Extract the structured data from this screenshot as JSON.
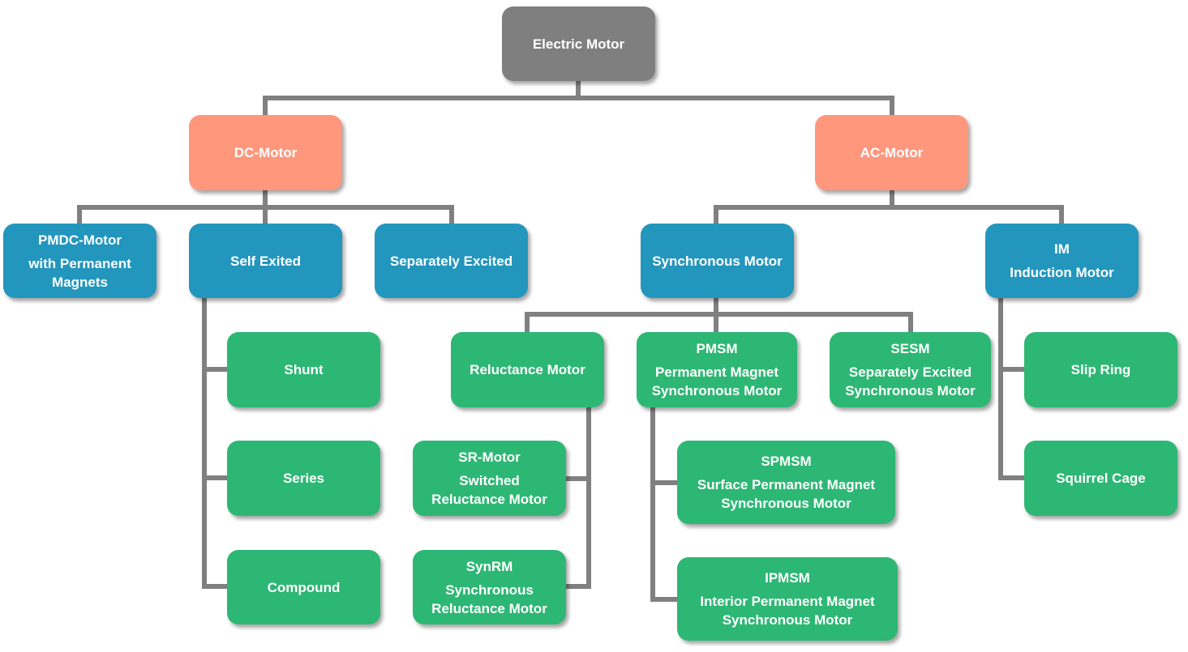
{
  "colors": {
    "root": "#7f7f7f",
    "level1": "#ff977d",
    "level2": "#2396bd",
    "level3": "#2db774",
    "connector": "#808080"
  },
  "root": {
    "label": "Electric Motor"
  },
  "dc": {
    "label": "DC-Motor",
    "pmdc": {
      "title": "PMDC-Motor",
      "subtitle": "with Permanent Magnets"
    },
    "self_excited": {
      "label": "Self Exited",
      "children": [
        "Shunt",
        "Series",
        "Compound"
      ]
    },
    "separately_excited": {
      "label": "Separately Excited"
    }
  },
  "ac": {
    "label": "AC-Motor",
    "synchronous": {
      "label": "Synchronous Motor",
      "reluctance": {
        "label": "Reluctance Motor",
        "sr": {
          "title": "SR-Motor",
          "subtitle": "Switched Reluctance Motor"
        },
        "synrm": {
          "title": "SynRM",
          "subtitle": "Synchronous Reluctance Motor"
        }
      },
      "pmsm": {
        "title": "PMSM",
        "subtitle": "Permanent Magnet Synchronous Motor",
        "spmsm": {
          "title": "SPMSM",
          "subtitle": "Surface Permanent Magnet Synchronous Motor"
        },
        "ipmsm": {
          "title": "IPMSM",
          "subtitle": "Interior Permanent Magnet Synchronous Motor"
        }
      },
      "sesm": {
        "title": "SESM",
        "subtitle": "Separately Excited Synchronous Motor"
      }
    },
    "induction": {
      "title": "IM",
      "subtitle": "Induction Motor",
      "children": [
        "Slip Ring",
        "Squirrel Cage"
      ]
    }
  }
}
